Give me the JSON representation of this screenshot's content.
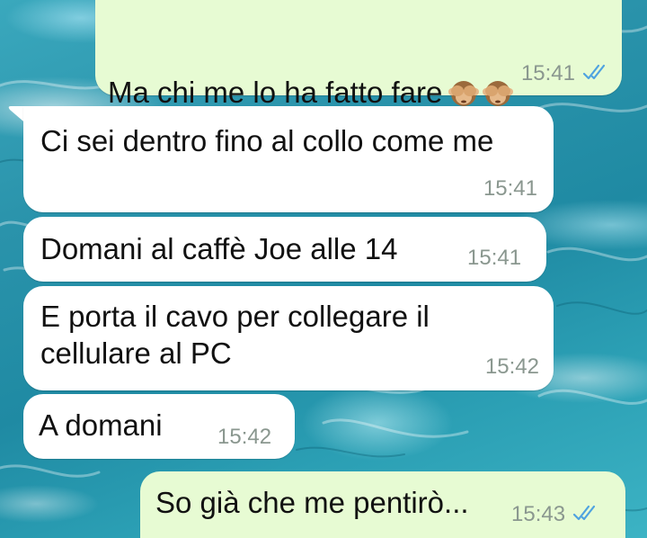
{
  "chat": {
    "messages": [
      {
        "direction": "outgoing",
        "text": "Ma chi me lo ha fatto fare",
        "emoji": [
          "see-no-evil-monkey",
          "see-no-evil-monkey"
        ],
        "time": "15:41",
        "status": "read",
        "status_icon": "double-check-icon"
      },
      {
        "direction": "incoming",
        "text": "Ci sei dentro fino al collo come me",
        "time": "15:41"
      },
      {
        "direction": "incoming",
        "text": "Domani al caffè Joe alle 14",
        "time": "15:41"
      },
      {
        "direction": "incoming",
        "text": "E porta il cavo per collegare il\ncellulare al PC",
        "time": "15:42"
      },
      {
        "direction": "incoming",
        "text": "A domani",
        "time": "15:42"
      },
      {
        "direction": "outgoing",
        "text": "So già che me pentirò...",
        "time": "15:43",
        "status": "read",
        "status_icon": "double-check-icon"
      }
    ]
  },
  "colors": {
    "outgoing_bubble": "#e7fbd3",
    "incoming_bubble": "#ffffff",
    "read_check": "#4fa3e0",
    "timestamp": "#8a978f"
  }
}
